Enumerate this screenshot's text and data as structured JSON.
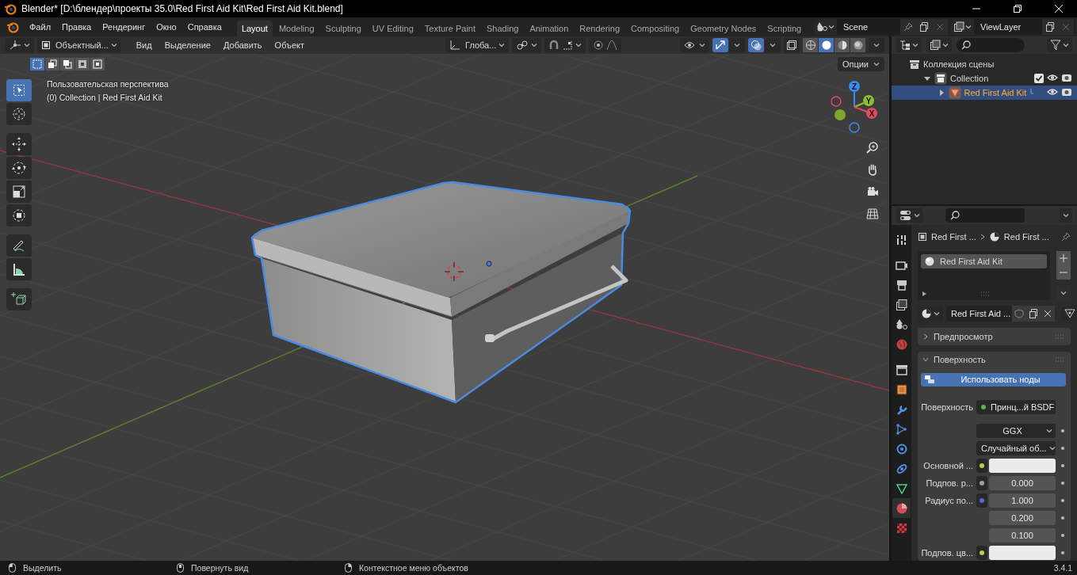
{
  "window": {
    "title": "Blender* [D:\\блендер\\проекты 35.0\\Red First Aid Kit\\Red First Aid Kit.blend]"
  },
  "menu_bar": {
    "menus": [
      "Файл",
      "Правка",
      "Рендеринг",
      "Окно",
      "Справка"
    ],
    "workspaces": [
      {
        "label": "Layout",
        "selected": true
      },
      {
        "label": "Modeling",
        "selected": false
      },
      {
        "label": "Sculpting",
        "selected": false
      },
      {
        "label": "UV Editing",
        "selected": false
      },
      {
        "label": "Texture Paint",
        "selected": false
      },
      {
        "label": "Shading",
        "selected": false
      },
      {
        "label": "Animation",
        "selected": false
      },
      {
        "label": "Rendering",
        "selected": false
      },
      {
        "label": "Compositing",
        "selected": false
      },
      {
        "label": "Geometry Nodes",
        "selected": false
      },
      {
        "label": "Scripting",
        "selected": false
      }
    ],
    "scene": "Scene",
    "view_layer": "ViewLayer"
  },
  "viewport": {
    "mode": "Объектный...",
    "menus": [
      "Вид",
      "Выделение",
      "Добавить",
      "Объект"
    ],
    "orientation": "Глоба...",
    "options": "Опции",
    "select_modes": [
      {
        "selected": true
      },
      {
        "selected": false
      },
      {
        "selected": false
      },
      {
        "selected": false
      },
      {
        "selected": false
      }
    ],
    "shading": [
      {
        "kind": "wireframe",
        "selected": false
      },
      {
        "kind": "solid",
        "selected": true
      },
      {
        "kind": "material",
        "selected": false
      },
      {
        "kind": "rendered",
        "selected": false
      }
    ],
    "overlay_lines": [
      "Пользовательская перспектива",
      "(0) Collection | Red First Aid Kit"
    ],
    "tools": [
      {
        "kind": "select",
        "selected": true
      },
      {
        "kind": "cursor",
        "selected": false
      },
      {
        "kind": "move",
        "selected": false
      },
      {
        "kind": "rotate",
        "selected": false
      },
      {
        "kind": "scale",
        "selected": false
      },
      {
        "kind": "transform",
        "selected": false
      },
      {
        "kind": "annotate",
        "selected": false
      },
      {
        "kind": "measure",
        "selected": false
      },
      {
        "kind": "add",
        "selected": false
      }
    ],
    "gizmo_axes": [
      "X",
      "Y",
      "Z"
    ]
  },
  "outliner": {
    "tree": [
      {
        "label": "Коллекция сцены",
        "selected": false,
        "children": [
          {
            "label": "Collection",
            "selected": false,
            "expanded": true,
            "checked": true,
            "visible": true,
            "children": [
              {
                "label": "Red First Aid Kit",
                "selected": true,
                "expanded": false,
                "visible": true
              }
            ]
          }
        ]
      }
    ]
  },
  "properties": {
    "tabs": [
      {
        "kind": "tool",
        "selected": false
      },
      {
        "kind": "render",
        "selected": false
      },
      {
        "kind": "output",
        "selected": false
      },
      {
        "kind": "view-layer",
        "selected": false
      },
      {
        "kind": "scene",
        "selected": false
      },
      {
        "kind": "world",
        "selected": false
      },
      {
        "kind": "collection",
        "selected": false
      },
      {
        "kind": "object",
        "selected": false
      },
      {
        "kind": "modifier",
        "selected": false
      },
      {
        "kind": "particles",
        "selected": false
      },
      {
        "kind": "physics",
        "selected": false
      },
      {
        "kind": "constraints",
        "selected": false
      },
      {
        "kind": "data",
        "selected": false
      },
      {
        "kind": "material",
        "selected": true
      },
      {
        "kind": "texture",
        "selected": false
      }
    ],
    "breadcrumb": [
      "Red First ...",
      "Red First ..."
    ],
    "material_slots": [
      {
        "label": "Red First Aid Kit",
        "selected": true
      }
    ],
    "material_name": "Red First Aid ...",
    "panels": [
      {
        "label": "Предпросмотр",
        "expanded": false
      },
      {
        "label": "Поверхность",
        "expanded": true
      }
    ],
    "use_nodes": "Использовать ноды",
    "fields": [
      {
        "kind": "socket",
        "label": "Поверхность",
        "value": "Принц...й BSDF",
        "color": "#4fb84f"
      },
      {
        "kind": "dropdown",
        "value": "GGX"
      },
      {
        "kind": "dropdown",
        "value": "Случайный об..."
      },
      {
        "kind": "swatch",
        "label": "Основной ...",
        "color": "#c7c74a"
      },
      {
        "kind": "number",
        "label": "Подпов. р...",
        "values": [
          "0.000"
        ],
        "color": "#a1a1a1"
      },
      {
        "kind": "number",
        "label": "Радиус по...",
        "values": [
          "1.000",
          "0.200",
          "0.100"
        ],
        "color": "#6363c7"
      },
      {
        "kind": "swatch",
        "label": "Подпов. цв...",
        "color": "#c7c74a"
      }
    ]
  },
  "status_bar": {
    "items": [
      "Выделить",
      "Повернуть вид",
      "Контекстное меню объектов"
    ],
    "version": "3.4.1"
  }
}
